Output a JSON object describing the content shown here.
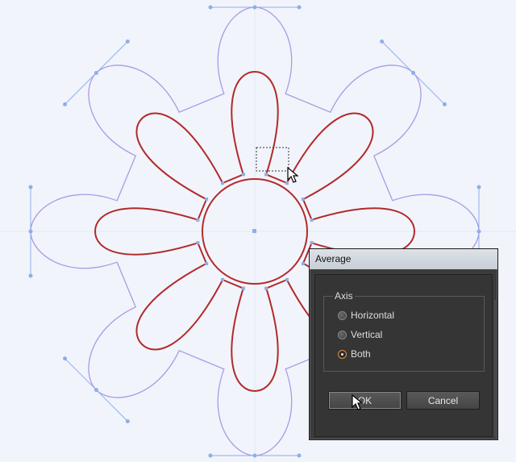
{
  "dialog": {
    "title": "Average",
    "group_label": "Axis",
    "options": [
      {
        "label": "Horizontal",
        "selected": false
      },
      {
        "label": "Vertical",
        "selected": false
      },
      {
        "label": "Both",
        "selected": true
      }
    ],
    "ok_label": "OK",
    "cancel_label": "Cancel"
  },
  "canvas": {
    "background": "#f1f4fb",
    "selected_path_color": "#b22a2a",
    "guide_path_color": "#a99be6",
    "handle_color": "#8faee8",
    "petals": 8
  }
}
